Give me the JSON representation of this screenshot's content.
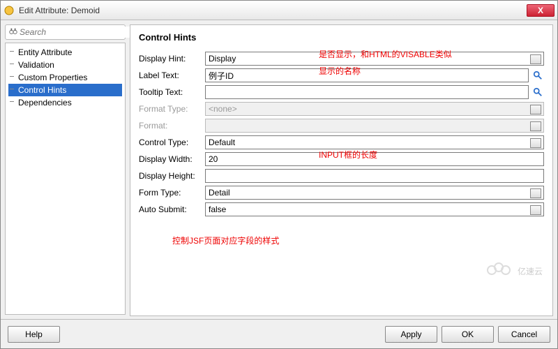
{
  "window": {
    "title": "Edit Attribute: Demoid",
    "close": "X"
  },
  "search": {
    "placeholder": "Search"
  },
  "tree": {
    "items": [
      {
        "label": "Entity Attribute"
      },
      {
        "label": "Validation"
      },
      {
        "label": "Custom Properties"
      },
      {
        "label": "Control Hints",
        "selected": true
      },
      {
        "label": "Dependencies"
      }
    ]
  },
  "panel": {
    "heading": "Control Hints",
    "rows": {
      "display_hint": {
        "label": "Display Hint:",
        "hot": "i",
        "value": "Display",
        "type": "dropdown"
      },
      "label_text": {
        "label": "Label Text:",
        "hot": "L",
        "value": "例子ID",
        "type": "text",
        "mag": true
      },
      "tooltip_text": {
        "label": "Tooltip Text:",
        "hot": "T",
        "value": "",
        "type": "text",
        "mag": true
      },
      "format_type": {
        "label": "Format Type:",
        "value": "<none>",
        "type": "dropdown",
        "disabled": true
      },
      "format": {
        "label": "Format:",
        "value": "",
        "type": "dropdown",
        "disabled": true
      },
      "control_type": {
        "label": "Control Type:",
        "hot": "C",
        "value": "Default",
        "type": "dropdown"
      },
      "display_width": {
        "label": "Display Width:",
        "hot": "W",
        "value": "20",
        "type": "text"
      },
      "display_height": {
        "label": "Display Height:",
        "value": "",
        "type": "text"
      },
      "form_type": {
        "label": "Form Type:",
        "hot": "F",
        "value": "Detail",
        "type": "dropdown"
      },
      "auto_submit": {
        "label": "Auto Submit:",
        "hot": "A",
        "value": "false",
        "type": "dropdown"
      }
    }
  },
  "annotations": {
    "a1": "是否显示，和HTML的VISABLE类似",
    "a2": "显示的名称",
    "a3": "INPUT框的长度",
    "a4": "控制JSF页面对应字段的样式"
  },
  "buttons": {
    "help": "Help",
    "apply": "Apply",
    "ok": "OK",
    "cancel": "Cancel"
  },
  "watermark": "亿速云"
}
